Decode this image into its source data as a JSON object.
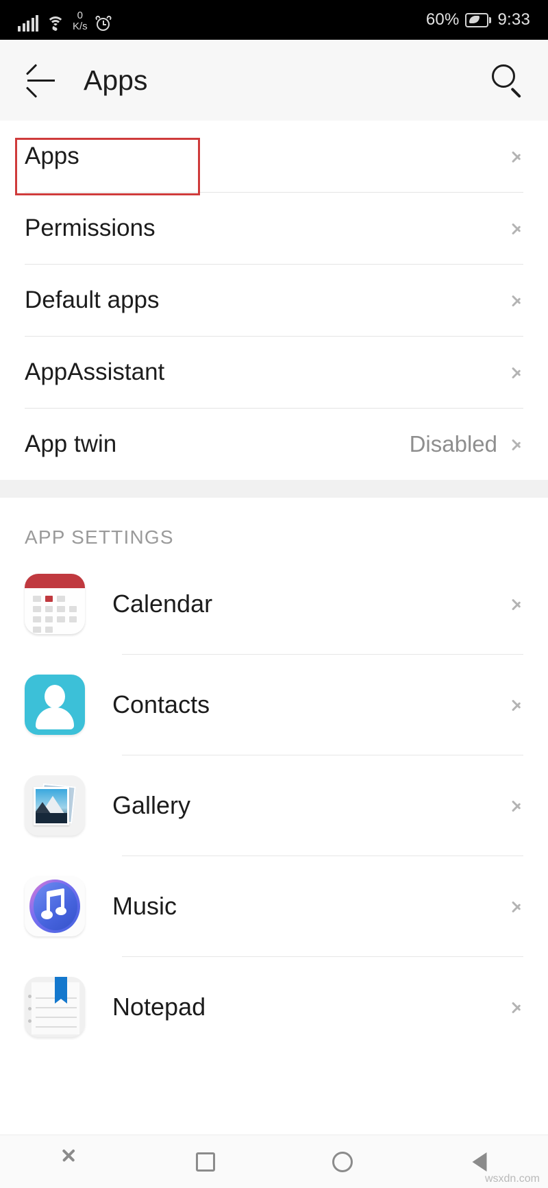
{
  "status_bar": {
    "signal_icon": "cellular-signal-icon",
    "wifi_icon": "wifi-icon",
    "data_rate_value": "0",
    "data_rate_unit": "K/s",
    "alarm_icon": "alarm-clock-icon",
    "battery_percent": "60%",
    "battery_icon": "battery-power-saving-icon",
    "time": "9:33"
  },
  "header": {
    "back_icon": "back-arrow-icon",
    "title": "Apps",
    "search_icon": "search-icon"
  },
  "settings_list": [
    {
      "label": "Apps",
      "value": "",
      "highlighted": true
    },
    {
      "label": "Permissions",
      "value": "",
      "highlighted": false
    },
    {
      "label": "Default apps",
      "value": "",
      "highlighted": false
    },
    {
      "label": "AppAssistant",
      "value": "",
      "highlighted": false
    },
    {
      "label": "App twin",
      "value": "Disabled",
      "highlighted": false
    }
  ],
  "app_settings": {
    "section_title": "APP SETTINGS",
    "items": [
      {
        "label": "Calendar",
        "icon": "calendar-app-icon"
      },
      {
        "label": "Contacts",
        "icon": "contacts-app-icon"
      },
      {
        "label": "Gallery",
        "icon": "gallery-app-icon"
      },
      {
        "label": "Music",
        "icon": "music-app-icon"
      },
      {
        "label": "Notepad",
        "icon": "notepad-app-icon"
      }
    ]
  },
  "nav_bar": {
    "items": [
      {
        "icon": "chevron-down-icon",
        "name": "hide-navbar-button"
      },
      {
        "icon": "square-icon",
        "name": "recents-button"
      },
      {
        "icon": "circle-icon",
        "name": "home-button"
      },
      {
        "icon": "triangle-back-icon",
        "name": "back-button"
      }
    ]
  },
  "annotation": {
    "highlight_color": "#cf3b3b"
  },
  "watermark": "wsxdn.com"
}
